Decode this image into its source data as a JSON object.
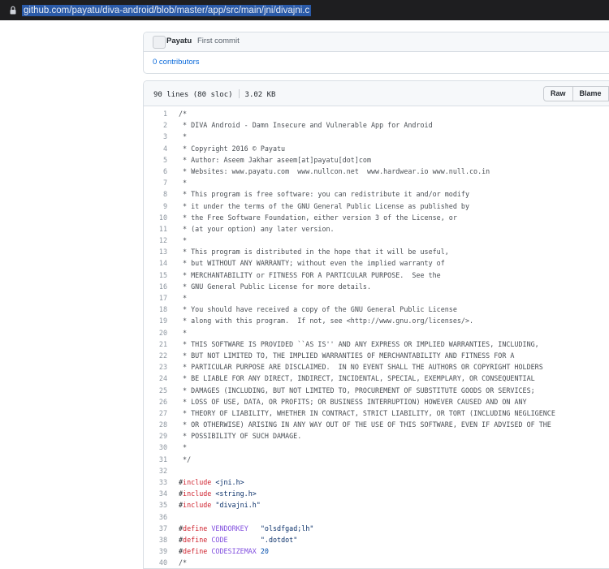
{
  "browser": {
    "url": "github.com/payatu/diva-android/blob/master/app/src/main/jni/divajni.c",
    "lock_icon": "lock-icon"
  },
  "commit": {
    "author": "Payatu",
    "message": "First commit",
    "avatar_icon": "avatar-icon",
    "contributors": "0 contributors"
  },
  "file": {
    "lines_info": "90 lines (80 sloc)",
    "size": "3.02 KB",
    "raw_label": "Raw",
    "blame_label": "Blame"
  },
  "code_lines": [
    {
      "n": "1",
      "t": "/*",
      "cls": "c"
    },
    {
      "n": "2",
      "t": " * DIVA Android - Damn Insecure and Vulnerable App for Android",
      "cls": "c"
    },
    {
      "n": "3",
      "t": " *",
      "cls": "c"
    },
    {
      "n": "4",
      "t": " * Copyright 2016 © Payatu",
      "cls": "c"
    },
    {
      "n": "5",
      "t": " * Author: Aseem Jakhar aseem[at]payatu[dot]com",
      "cls": "c"
    },
    {
      "n": "6",
      "t": " * Websites: www.payatu.com  www.nullcon.net  www.hardwear.io www.null.co.in",
      "cls": "c"
    },
    {
      "n": "7",
      "t": " *",
      "cls": "c"
    },
    {
      "n": "8",
      "t": " * This program is free software: you can redistribute it and/or modify",
      "cls": "c"
    },
    {
      "n": "9",
      "t": " * it under the terms of the GNU General Public License as published by",
      "cls": "c"
    },
    {
      "n": "10",
      "t": " * the Free Software Foundation, either version 3 of the License, or",
      "cls": "c"
    },
    {
      "n": "11",
      "t": " * (at your option) any later version.",
      "cls": "c"
    },
    {
      "n": "12",
      "t": " *",
      "cls": "c"
    },
    {
      "n": "13",
      "t": " * This program is distributed in the hope that it will be useful,",
      "cls": "c"
    },
    {
      "n": "14",
      "t": " * but WITHOUT ANY WARRANTY; without even the implied warranty of",
      "cls": "c"
    },
    {
      "n": "15",
      "t": " * MERCHANTABILITY or FITNESS FOR A PARTICULAR PURPOSE.  See the",
      "cls": "c"
    },
    {
      "n": "16",
      "t": " * GNU General Public License for more details.",
      "cls": "c"
    },
    {
      "n": "17",
      "t": " *",
      "cls": "c"
    },
    {
      "n": "18",
      "t": " * You should have received a copy of the GNU General Public License",
      "cls": "c"
    },
    {
      "n": "19",
      "t": " * along with this program.  If not, see <http://www.gnu.org/licenses/>.",
      "cls": "c"
    },
    {
      "n": "20",
      "t": " *",
      "cls": "c"
    },
    {
      "n": "21",
      "t": " * THIS SOFTWARE IS PROVIDED ``AS IS'' AND ANY EXPRESS OR IMPLIED WARRANTIES, INCLUDING,",
      "cls": "c"
    },
    {
      "n": "22",
      "t": " * BUT NOT LIMITED TO, THE IMPLIED WARRANTIES OF MERCHANTABILITY AND FITNESS FOR A",
      "cls": "c"
    },
    {
      "n": "23",
      "t": " * PARTICULAR PURPOSE ARE DISCLAIMED.  IN NO EVENT SHALL THE AUTHORS OR COPYRIGHT HOLDERS",
      "cls": "c"
    },
    {
      "n": "24",
      "t": " * BE LIABLE FOR ANY DIRECT, INDIRECT, INCIDENTAL, SPECIAL, EXEMPLARY, OR CONSEQUENTIAL",
      "cls": "c"
    },
    {
      "n": "25",
      "t": " * DAMAGES (INCLUDING, BUT NOT LIMITED TO, PROCUREMENT OF SUBSTITUTE GOODS OR SERVICES;",
      "cls": "c"
    },
    {
      "n": "26",
      "t": " * LOSS OF USE, DATA, OR PROFITS; OR BUSINESS INTERRUPTION) HOWEVER CAUSED AND ON ANY",
      "cls": "c"
    },
    {
      "n": "27",
      "t": " * THEORY OF LIABILITY, WHETHER IN CONTRACT, STRICT LIABILITY, OR TORT (INCLUDING NEGLIGENCE",
      "cls": "c"
    },
    {
      "n": "28",
      "t": " * OR OTHERWISE) ARISING IN ANY WAY OUT OF THE USE OF THIS SOFTWARE, EVEN IF ADVISED OF THE",
      "cls": "c"
    },
    {
      "n": "29",
      "t": " * POSSIBILITY OF SUCH DAMAGE.",
      "cls": "c"
    },
    {
      "n": "30",
      "t": " *",
      "cls": "c"
    },
    {
      "n": "31",
      "t": " */",
      "cls": "c"
    },
    {
      "n": "32",
      "t": "",
      "cls": "c"
    },
    {
      "n": "33",
      "parts": [
        {
          "t": "#",
          "cls": ""
        },
        {
          "t": "include",
          "cls": "k"
        },
        {
          "t": " <jni.h>",
          "cls": "s"
        }
      ]
    },
    {
      "n": "34",
      "parts": [
        {
          "t": "#",
          "cls": ""
        },
        {
          "t": "include",
          "cls": "k"
        },
        {
          "t": " <string.h>",
          "cls": "s"
        }
      ]
    },
    {
      "n": "35",
      "parts": [
        {
          "t": "#",
          "cls": ""
        },
        {
          "t": "include",
          "cls": "k"
        },
        {
          "t": " \"divajni.h\"",
          "cls": "s"
        }
      ]
    },
    {
      "n": "36",
      "t": "",
      "cls": "c"
    },
    {
      "n": "37",
      "parts": [
        {
          "t": "#",
          "cls": ""
        },
        {
          "t": "define",
          "cls": "k"
        },
        {
          "t": " ",
          "cls": ""
        },
        {
          "t": "VENDORKEY",
          "cls": "m"
        },
        {
          "t": "   \"olsdfgad;lh\"",
          "cls": "s"
        }
      ]
    },
    {
      "n": "38",
      "parts": [
        {
          "t": "#",
          "cls": ""
        },
        {
          "t": "define",
          "cls": "k"
        },
        {
          "t": " ",
          "cls": ""
        },
        {
          "t": "CODE",
          "cls": "m"
        },
        {
          "t": "        \".dotdot\"",
          "cls": "s"
        }
      ]
    },
    {
      "n": "39",
      "parts": [
        {
          "t": "#",
          "cls": ""
        },
        {
          "t": "define",
          "cls": "k"
        },
        {
          "t": " ",
          "cls": ""
        },
        {
          "t": "CODESIZEMAX",
          "cls": "m"
        },
        {
          "t": " ",
          "cls": ""
        },
        {
          "t": "20",
          "cls": "n"
        }
      ]
    },
    {
      "n": "40",
      "t": "/*",
      "cls": "c"
    }
  ]
}
